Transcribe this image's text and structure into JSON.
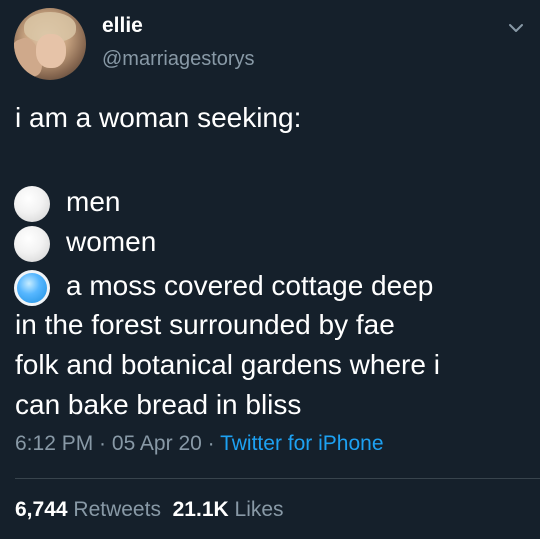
{
  "user": {
    "display_name": "ellie",
    "handle": "@marriagestorys"
  },
  "tweet": {
    "intro": "i am a woman seeking:",
    "options": [
      {
        "label": "men",
        "selected": false
      },
      {
        "label": "women",
        "selected": false
      },
      {
        "label": "a moss covered cottage deep",
        "selected": true
      }
    ],
    "continuation": [
      "in the forest surrounded by fae",
      "folk and botanical gardens where i",
      "can bake bread in bliss"
    ]
  },
  "meta": {
    "time": "6:12 PM",
    "sep1": " · ",
    "date": "05 Apr 20",
    "sep2": " · ",
    "source": "Twitter for iPhone"
  },
  "stats": {
    "retweets_count": "6,744",
    "retweets_label": "Retweets",
    "likes_count": "21.1K",
    "likes_label": "Likes"
  },
  "colors": {
    "background": "#15202b",
    "text": "#ffffff",
    "secondary": "#8899a6",
    "link": "#1da1f2",
    "selected_radio": "#1d8fe0"
  },
  "icons": {
    "menu": "chevron-down-icon"
  }
}
